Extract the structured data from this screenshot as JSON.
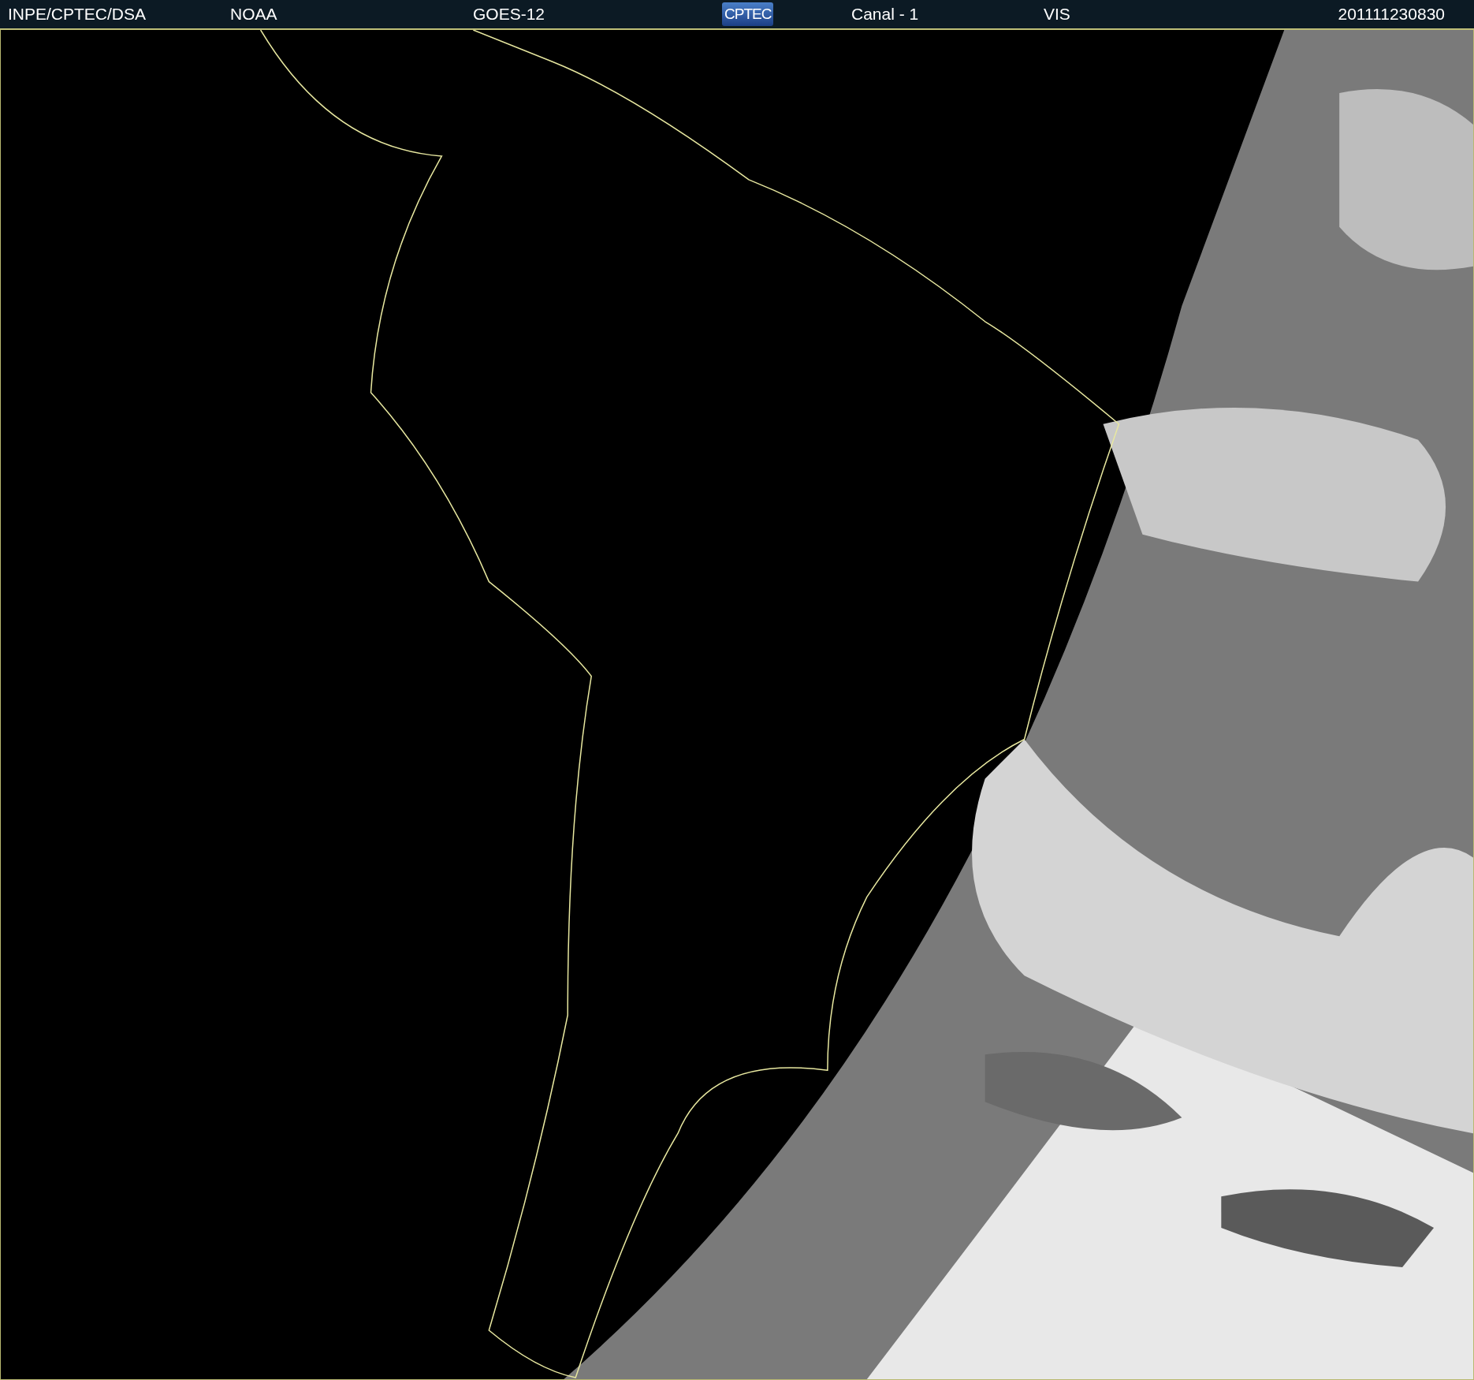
{
  "header": {
    "items": [
      {
        "kind": "text",
        "text": "INPE/CPTEC/DSA"
      },
      {
        "kind": "text",
        "text": "NOAA"
      },
      {
        "kind": "text",
        "text": "GOES-12"
      },
      {
        "kind": "logo",
        "text": "CPTEC"
      },
      {
        "kind": "text",
        "text": "Canal - 1"
      },
      {
        "kind": "text",
        "text": "VIS"
      },
      {
        "kind": "text",
        "text": "201111230830"
      }
    ]
  }
}
